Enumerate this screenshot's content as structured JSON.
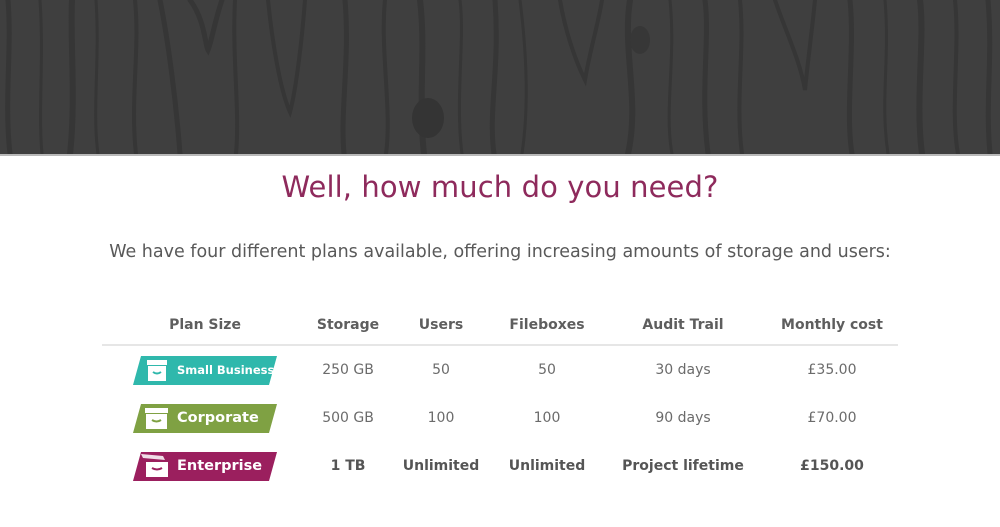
{
  "hero": {
    "pattern_icon": "wood-grain-texture"
  },
  "heading": "Well, how much do you need?",
  "subheading": "We have four different plans available, offering increasing amounts of storage and users:",
  "table": {
    "headers": [
      "Plan Size",
      "Storage",
      "Users",
      "Fileboxes",
      "Audit Trail",
      "Monthly cost"
    ],
    "rows": [
      {
        "plan": "Small Business",
        "icon": "archive-box-icon",
        "color": "#2fb8ac",
        "storage": "250 GB",
        "users": "50",
        "fileboxes": "50",
        "audit": "30 days",
        "cost": "£35.00"
      },
      {
        "plan": "Corporate",
        "icon": "archive-box-icon",
        "color": "#7fa143",
        "storage": "500 GB",
        "users": "100",
        "fileboxes": "100",
        "audit": "90 days",
        "cost": "£70.00"
      },
      {
        "plan": "Enterprise",
        "icon": "open-archive-box-icon",
        "color": "#9b1f5e",
        "storage": "1 TB",
        "users": "Unlimited",
        "fileboxes": "Unlimited",
        "audit": "Project lifetime",
        "cost": "£150.00"
      }
    ]
  }
}
